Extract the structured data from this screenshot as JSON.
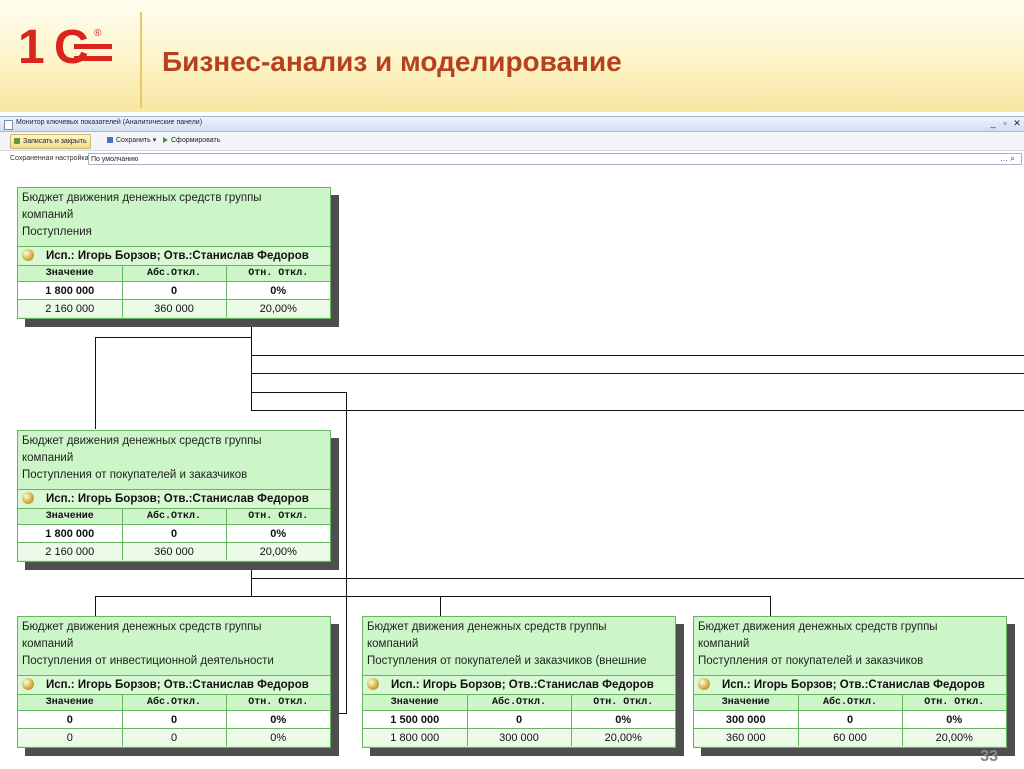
{
  "slide": {
    "title": "Бизнес-анализ и моделирование",
    "page_number": "33",
    "brand_color": "#d9251c",
    "title_color": "#b5411e"
  },
  "window": {
    "title": "Монитор ключевых показателей (Аналитические панели)",
    "controls": {
      "minimize": "_",
      "restore": "▫",
      "close": "✕"
    }
  },
  "toolbar": {
    "save_close_label": "Записать и закрыть",
    "save_label": "Сохранить ▾",
    "generate_label": "Сформировать",
    "save_icon": "floppy-icon",
    "generate_icon": "play-icon"
  },
  "settings": {
    "label": "Сохраненная настройка:",
    "value": "По умолчанию"
  },
  "panels": [
    {
      "title_lines": [
        "Бюджет движения денежных средств группы",
        "компаний",
        "Поступления"
      ],
      "people": "Исп.: Игорь Борзов; Отв.:Станислав Федоров",
      "headers": [
        "Значение",
        "Абс.Откл.",
        "Отн. Откл."
      ],
      "current": [
        "1 800 000",
        "0",
        "0%"
      ],
      "previous": [
        "2 160 000",
        "360 000",
        "20,00%"
      ]
    },
    {
      "title_lines": [
        "Бюджет движения денежных средств группы",
        "компаний",
        "Поступления от покупателей и заказчиков"
      ],
      "people": "Исп.: Игорь Борзов; Отв.:Станислав Федоров",
      "headers": [
        "Значение",
        "Абс.Откл.",
        "Отн. Откл."
      ],
      "current": [
        "1 800 000",
        "0",
        "0%"
      ],
      "previous": [
        "2 160 000",
        "360 000",
        "20,00%"
      ]
    },
    {
      "title_lines": [
        "Бюджет движения денежных средств группы",
        "компаний",
        "Поступления от инвестиционной деятельности"
      ],
      "people": "Исп.: Игорь Борзов; Отв.:Станислав Федоров",
      "headers": [
        "Значение",
        "Абс.Откл.",
        "Отн. Откл."
      ],
      "current": [
        "0",
        "0",
        "0%"
      ],
      "previous": [
        "0",
        "0",
        "0%"
      ]
    },
    {
      "title_lines": [
        "Бюджет движения денежных средств группы",
        "компаний",
        "Поступления от покупателей и заказчиков (внешние"
      ],
      "people": "Исп.: Игорь Борзов; Отв.:Станислав Федоров",
      "headers": [
        "Значение",
        "Абс.Откл.",
        "Отн. Откл."
      ],
      "current": [
        "1 500 000",
        "0",
        "0%"
      ],
      "previous": [
        "1 800 000",
        "300 000",
        "20,00%"
      ]
    },
    {
      "title_lines": [
        "Бюджет движения денежных средств группы",
        "компаний",
        "Поступления от покупателей и заказчиков"
      ],
      "people": "Исп.: Игорь Борзов; Отв.:Станислав Федоров",
      "headers": [
        "Значение",
        "Абс.Откл.",
        "Отн. Откл."
      ],
      "current": [
        "300 000",
        "0",
        "0%"
      ],
      "previous": [
        "360 000",
        "60 000",
        "20,00%"
      ]
    }
  ],
  "colors": {
    "panel_fill": "#ccf5c8",
    "panel_border": "#69b463",
    "panel_shadow": "#4e4e4e",
    "header_gradient_end": "#f8e6a0"
  }
}
